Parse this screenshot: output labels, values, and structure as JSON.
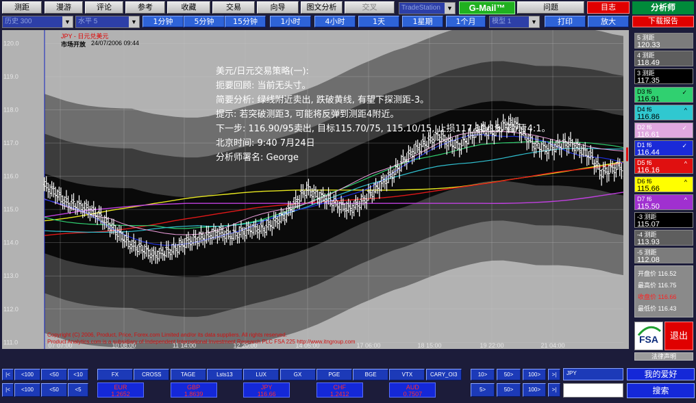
{
  "menu": {
    "items": [
      "测距",
      "漫游",
      "评论",
      "参考",
      "收藏",
      "交易",
      "向导",
      "图文分析",
      "交叉"
    ],
    "select_value": "TradeStation",
    "gmail_label": "G-Mail™",
    "faq_label": "问题",
    "exit_label": "目志",
    "analyst_label": "分析师"
  },
  "toolbar": {
    "history_select": "历史 300",
    "level_select": "水平 5",
    "timeframes": [
      "1分钟",
      "5分钟",
      "15分钟",
      "1小时",
      "4小时",
      "1天",
      "1星期",
      "1个月"
    ],
    "model_select": "模型 1",
    "print_label": "打印",
    "zoom_label": "放大",
    "download_label": "下载报告"
  },
  "chart_header": {
    "symbol": "JPY - 日元兑美元",
    "status": "市场开放",
    "datetime": "24/07/2006 09:44"
  },
  "strategy": {
    "lines": [
      "美元/日元交易策略(一):",
      "扼要回顾:  当前无头寸。",
      "简要分析:  绿线附近卖出, 跌破黄线, 有望下探测距-3。",
      "提示:  若突破测距3, 可能将反弹到测距4附近。",
      "下一步:  116.90/95卖出, 目标115.70/75, 115.10/15, 止损117.10/15, 盈/亏4:1。",
      "北京时间:  9:40   7月24日",
      "分析师署名:  George"
    ]
  },
  "copyright": {
    "line1": "Copyright (C) 2006, Product, Price, Forex.com Limited and/or its data suppliers. All rights reserved.",
    "line2": "Product Analytics.com is a subsidiary of Independent International Investment Research PLC FSA 225 http://www.itngroup.com"
  },
  "colors": {
    "plot_bg": "#b2b2b2",
    "band_outer": "#6e6e6e",
    "band_mid": "#3c3c3c",
    "band_inner": "#0a0a0a",
    "ma_red": "#e01818",
    "ma_yellow": "#e8e820",
    "ma_purple": "#c040e0",
    "ma_blue": "#2030e0",
    "ma_green": "#30d070",
    "ma_cyan": "#30c0d0",
    "ma_pink": "#f0a0e0"
  },
  "chart_data": {
    "type": "ohlc",
    "title": "",
    "ylim": [
      110.8,
      120.4
    ],
    "y_ticks": [
      "120.0",
      "119.0",
      "118.0",
      "117.0",
      "116.0",
      "115.0",
      "114.0",
      "113.0",
      "112.0",
      "111.0"
    ],
    "x_ticks": [
      "07 07:00",
      "10 08:00",
      "11 14:00",
      "12 20:00",
      "14 05:00",
      "17 06:00",
      "18 15:00",
      "19 22:00",
      "21 04:00"
    ],
    "series": [
      {
        "name": "USD/JPY",
        "values": [
          115.7,
          115.5,
          115.2,
          115.1,
          115.0,
          114.8,
          114.5,
          114.2,
          113.9,
          113.8,
          113.6,
          113.7,
          113.8,
          114.0,
          114.1,
          114.2,
          114.3,
          114.2,
          114.3,
          114.4,
          114.4,
          114.6,
          114.8,
          115.2,
          115.6,
          115.4,
          115.3,
          115.1,
          115.0,
          115.2,
          115.5,
          115.8,
          116.1,
          116.5,
          116.8,
          117.0,
          117.2,
          117.0,
          116.9,
          117.2,
          117.4,
          117.3,
          117.5,
          117.6,
          117.2,
          116.9,
          116.8,
          116.9,
          117.0,
          116.8,
          116.6,
          116.1,
          116.2,
          116.3
        ]
      }
    ],
    "bands": [
      {
        "name": "5 测距",
        "value": "120.33"
      },
      {
        "name": "4 测距",
        "value": "118.49"
      },
      {
        "name": "3 测距",
        "value": "117.35"
      },
      {
        "name": "-3 测距",
        "value": "115.07"
      },
      {
        "name": "-4 测距",
        "value": "113.93"
      },
      {
        "name": "-5 测距",
        "value": "112.08"
      }
    ],
    "ma_lines": [
      {
        "name": "D3 f6",
        "value": "116.91"
      },
      {
        "name": "D4 f6",
        "value": "116.86"
      },
      {
        "name": "D2 f6",
        "value": "116.61"
      },
      {
        "name": "D1 f6",
        "value": "116.44"
      },
      {
        "name": "D5 f6",
        "value": "116.16"
      },
      {
        "name": "D6 f6",
        "value": "115.66"
      },
      {
        "name": "D7 f6",
        "value": "115.50"
      }
    ]
  },
  "price_panel": {
    "open_label": "开盘价",
    "open": "116.52",
    "high_label": "最高价",
    "high": "116.75",
    "close_label": "收盘价",
    "close": "116.66",
    "low_label": "最低价",
    "low": "116.43"
  },
  "side": {
    "fsa": "FSA",
    "exit": "退出",
    "legal": "法律声明"
  },
  "bottom": {
    "nav_left_top": [
      "|<",
      "<100",
      "<50",
      "<10"
    ],
    "nav_left_bottom": [
      "|<",
      "<100",
      "<50",
      "<5"
    ],
    "indicators": [
      "FX",
      "CROSS",
      "TAGE",
      "Lsts13",
      "LUX",
      "GX",
      "PGE",
      "BGE",
      "VTX",
      "CARY_OI3"
    ],
    "currencies": [
      {
        "name": "EUR",
        "value": "1.2652"
      },
      {
        "name": "GBP",
        "value": "1.8639"
      },
      {
        "name": "JPY",
        "value": "116.66"
      },
      {
        "name": "CHF",
        "value": "1.2412"
      },
      {
        "name": "AUD",
        "value": "0.7507"
      }
    ],
    "nav_right_top": [
      "10>",
      "50>",
      "100>",
      ">|"
    ],
    "nav_right_bottom": [
      "5>",
      "50>",
      "100>",
      ">|"
    ],
    "symbol_input": "JPY",
    "favorites_label": "我的爱好",
    "search_label": "搜索"
  }
}
